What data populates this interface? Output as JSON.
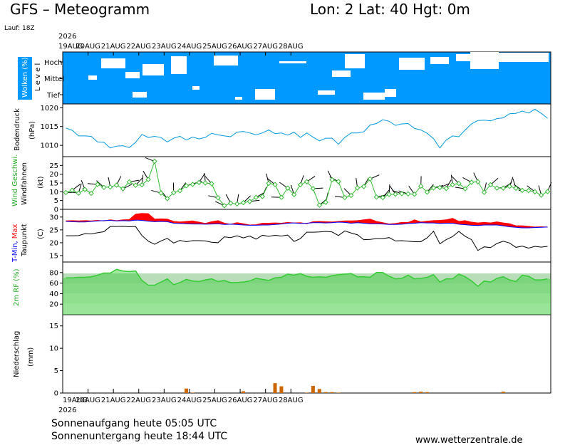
{
  "header": {
    "title": "GFS – Meteogramm",
    "location": "Lon: 2  Lat: 40  Hgt: 0m",
    "run": "Lauf: 18Z",
    "year": "2026"
  },
  "dates": [
    "19AUG",
    "20AUG",
    "21AUG",
    "22AUG",
    "23AUG",
    "24AUG",
    "25AUG",
    "26AUG",
    "27AUG",
    "28AUG"
  ],
  "panels": {
    "clouds": {
      "ylabel": "Wolken (%)",
      "level_word": "L e v e l",
      "levels": [
        "Hoch",
        "Mittel",
        "Tief"
      ]
    },
    "pressure": {
      "ylabel": "Bodendruck",
      "unit": "(hPa)",
      "ticks": [
        "1020",
        "1015",
        "1010"
      ]
    },
    "wind": {
      "ylabel_1": "Wind Geschwi.",
      "ylabel_2": "Windfahnen",
      "unit": "(kt)",
      "ticks": [
        "25",
        "20",
        "15",
        "10",
        "5",
        "0"
      ]
    },
    "temperature": {
      "ylabel_min": "T-Min,",
      "ylabel_max": "Max",
      "ylabel_dew": "Taupunkt",
      "unit": "(C)",
      "ticks": [
        "30",
        "25",
        "20",
        "15"
      ]
    },
    "humidity": {
      "ylabel": "2m RF (%)",
      "ticks": [
        "80",
        "60",
        "40",
        "20"
      ]
    },
    "precip": {
      "ylabel": "Niederschlag",
      "unit": "(mm)",
      "ticks": [
        "15",
        "10",
        "5",
        "0"
      ]
    }
  },
  "footer": {
    "sunrise": "Sonnenaufgang heute 05:05 UTC",
    "sunset": "Sonnenuntergang heute 18:44 UTC",
    "source": "www.wetterzentrale.de"
  },
  "colors": {
    "cloud_sky": "#0099ff",
    "pressure_line": "#0099dd",
    "wind_speed": "#33bb33",
    "temp_max": "#ff0000",
    "temp_min": "#0000ff",
    "dewpoint": "#000000",
    "humidity_fill": "#33cc33",
    "precip_bar": "#cc6600"
  },
  "chart_data": {
    "type": "line",
    "x_start": "2026-08-19 00Z",
    "x_step_hours": 6,
    "series": [
      {
        "name": "Bodendruck",
        "unit": "hPa",
        "values": [
          1014.6,
          1014,
          1012.5,
          1012.5,
          1012.4,
          1010.9,
          1010.8,
          1009.3,
          1009.8,
          1009.9,
          1009.4,
          1010.8,
          1012.9,
          1012.1,
          1012.4,
          1012.1,
          1010.9,
          1011.9,
          1012.4,
          1011.4,
          1012.2,
          1011.7,
          1012.1,
          1013.2,
          1012.8,
          1012.5,
          1012.3,
          1013.5,
          1013.7,
          1013.3,
          1012.8,
          1013.3,
          1014.1,
          1013.1,
          1013.3,
          1012.7,
          1013.5,
          1012.1,
          1013.3,
          1012.2,
          1011.2,
          1011.9,
          1011.9,
          1010.3,
          1012.1,
          1013.3,
          1013.3,
          1013.6,
          1015.4,
          1015.8,
          1016.8,
          1016.4,
          1015.3,
          1015.7,
          1015.8,
          1014.5,
          1014.1,
          1013.2,
          1011.8,
          1009.3,
          1011.4,
          1012.5,
          1012.3,
          1014.1,
          1015.7,
          1016.6,
          1016.7,
          1016.5,
          1017.1,
          1017.3,
          1018.4,
          1018.5,
          1019.1,
          1018.6,
          1019.6,
          1018.5,
          1017.2
        ]
      },
      {
        "name": "Wind Geschwi.",
        "unit": "kt",
        "values": [
          9.6,
          10.9,
          9.2,
          11.3,
          9.1,
          14.2,
          12.5,
          12.7,
          13.8,
          11.7,
          15.6,
          13.7,
          14,
          17,
          27.3,
          9.3,
          6.1,
          9.5,
          10.6,
          13.4,
          14.2,
          15.3,
          15,
          14.6,
          6.6,
          2.1,
          3.5,
          3.1,
          3.8,
          4.5,
          6.8,
          7.3,
          14.8,
          14.1,
          6.8,
          12.1,
          8.4,
          14,
          15.7,
          11.8,
          2.4,
          4,
          16.8,
          15.8,
          6.7,
          7.9,
          12.2,
          13,
          17.3,
          7,
          6.7,
          8.5,
          8.6,
          8.9,
          8.8,
          8.6,
          13.2,
          9.8,
          12.2,
          12.4,
          11.9,
          14,
          14.7,
          11.7,
          15.4,
          15.7,
          9.7,
          14,
          12.1,
          12.1,
          13.1,
          12,
          10.8,
          10.7,
          10,
          8.1,
          10.1
        ]
      },
      {
        "name": "T-Max",
        "unit": "C",
        "values": [
          28.5,
          28.6,
          28.5,
          28.6,
          28.5,
          28.7,
          28.5,
          28.9,
          28.6,
          28.9,
          29,
          31.1,
          31.4,
          31.3,
          29.2,
          29.3,
          29.2,
          28.3,
          28.1,
          28.3,
          28.5,
          28,
          27.5,
          28.2,
          28.6,
          27.6,
          27.2,
          27.8,
          27.4,
          26.9,
          27,
          27.6,
          27.6,
          27.7,
          27.6,
          27.9,
          27.7,
          27.8,
          27.4,
          28.2,
          28.3,
          28.2,
          28.1,
          28.3,
          28.5,
          28.5,
          28.6,
          28.9,
          29.2,
          28.3,
          27.8,
          27.3,
          27.5,
          27.9,
          27.9,
          28.9,
          28.1,
          28.4,
          28.6,
          28.7,
          28.9,
          29.5,
          28.3,
          28.6,
          28,
          27.7,
          27.9,
          27.7,
          28.1,
          27.7,
          27.4,
          26.6,
          26.6,
          26.4,
          26.1,
          26.2,
          26.1
        ]
      },
      {
        "name": "T-Min",
        "unit": "C",
        "values": [
          28.3,
          28.2,
          28.1,
          28.1,
          28.3,
          28.5,
          28.6,
          28.7,
          28.5,
          28.6,
          28.5,
          28.8,
          28.7,
          28.4,
          28.2,
          28.3,
          28.2,
          27.6,
          27.5,
          27.4,
          27.3,
          27.3,
          27.2,
          27.3,
          27.4,
          27.1,
          27.2,
          27.1,
          26.9,
          26.8,
          26.8,
          26.9,
          26.9,
          27.1,
          27.3,
          27.6,
          27.7,
          27.5,
          27.6,
          27.8,
          27.8,
          27.7,
          27.8,
          28,
          27.9,
          27.6,
          27.8,
          27.6,
          27.4,
          27.4,
          27.3,
          27.1,
          27.1,
          27.2,
          27.5,
          27.6,
          27.8,
          27.7,
          27.7,
          27.5,
          27.6,
          27.6,
          27.2,
          27,
          26.8,
          26.7,
          26.9,
          26.9,
          26.9,
          26.6,
          26.2,
          26,
          25.8,
          25.8,
          25.9,
          26,
          26.1
        ]
      },
      {
        "name": "Taupunkt",
        "unit": "C",
        "values": [
          22.7,
          22.7,
          22.8,
          23.5,
          23.4,
          23.9,
          24.3,
          26.3,
          26.3,
          26.4,
          26.2,
          26.3,
          22.8,
          20.6,
          19.4,
          20.7,
          21.7,
          19.9,
          20.9,
          20.4,
          20.8,
          20.8,
          20.7,
          20.2,
          20,
          22.3,
          22,
          22.7,
          21.9,
          22.6,
          21.4,
          22.9,
          22.5,
          22.9,
          22.6,
          23,
          20.5,
          21.6,
          24.1,
          24.1,
          24.2,
          24.4,
          24.2,
          22.8,
          24.6,
          23.8,
          23.1,
          21.2,
          21.3,
          21.6,
          21.6,
          22,
          20.7,
          20.8,
          20.6,
          20.4,
          20.4,
          21.9,
          24.5,
          19.6,
          21.2,
          22.4,
          24.4,
          22.5,
          21.2,
          17,
          18.4,
          18.1,
          19.7,
          20.6,
          19.9,
          18.2,
          18.7,
          17.9,
          18.6,
          18.3,
          18.6
        ]
      },
      {
        "name": "2m RF",
        "unit": "%",
        "values": [
          70,
          70,
          71,
          71,
          72,
          75,
          79,
          79,
          86,
          83,
          82,
          83,
          65,
          56,
          56,
          62,
          68,
          57,
          61,
          67,
          64,
          63,
          66,
          68,
          63,
          65,
          61,
          61,
          62,
          64,
          69,
          67,
          65,
          70,
          71,
          77,
          75,
          78,
          73,
          71,
          72,
          71,
          74,
          76,
          77,
          78,
          72,
          72,
          71,
          80,
          80,
          73,
          68,
          69,
          75,
          68,
          69,
          71,
          76,
          62,
          68,
          68,
          77,
          72,
          64,
          54,
          64,
          62,
          69,
          72,
          66,
          63,
          75,
          73,
          66,
          66,
          68
        ]
      },
      {
        "name": "Niederschlag",
        "unit": "mm",
        "values": [
          0,
          0,
          0,
          0,
          0,
          0,
          0,
          0,
          0,
          0,
          0,
          0,
          0,
          0,
          0,
          0,
          0,
          0,
          0,
          1.0,
          0.1,
          0,
          0,
          0,
          0,
          0,
          0,
          0,
          0.4,
          0,
          0,
          0,
          0,
          2.2,
          1.5,
          0,
          0,
          0,
          0.1,
          1.6,
          0.9,
          0.2,
          0.2,
          0.1,
          0,
          0,
          0,
          0,
          0,
          0,
          0,
          0,
          0,
          0,
          0,
          0.2,
          0.3,
          0.2,
          0,
          0,
          0,
          0,
          0,
          0,
          0,
          0,
          0,
          0,
          0,
          0.3,
          0,
          0,
          0,
          0,
          0,
          0,
          0
        ]
      }
    ],
    "axes": {
      "pressure_ylim": [
        1007,
        1021
      ],
      "wind_ylim": [
        0,
        30
      ],
      "temp_ylim": [
        12.5,
        33
      ],
      "humidity_ylim": [
        0,
        100
      ],
      "precip_ylim": [
        0,
        17.5
      ]
    }
  }
}
